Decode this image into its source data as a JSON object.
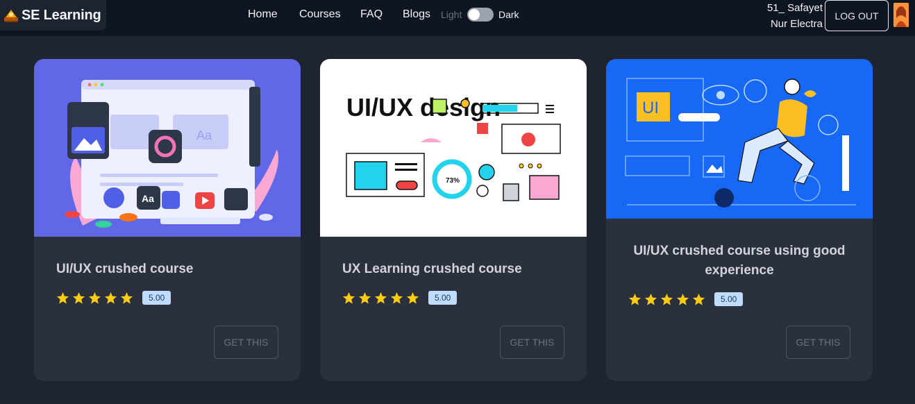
{
  "navbar": {
    "brand": "SE Learning",
    "links": [
      "Home",
      "Courses",
      "FAQ",
      "Blogs"
    ],
    "theme_light": "Light",
    "theme_dark": "Dark",
    "user_name": "51_ Safayet Nur Electra",
    "logout": "LOG OUT"
  },
  "courses": [
    {
      "title": "UI/UX crushed course",
      "rating": "5.00",
      "stars": 5,
      "button": "GET THIS"
    },
    {
      "title": "UX Learning crushed course",
      "rating": "5.00",
      "stars": 5,
      "button": "GET THIS",
      "image_text": "UI/UX design"
    },
    {
      "title": "UI/UX crushed course using good experience",
      "rating": "5.00",
      "stars": 5,
      "button": "GET THIS",
      "image_text": "UI"
    }
  ],
  "colors": {
    "page_bg": "#1e2430",
    "navbar_bg": "#0f1521",
    "card_bg": "#2a303c",
    "star": "#facc15",
    "badge_bg": "#bfdbfe"
  },
  "icons": [
    "se-learning-logo-icon",
    "star-icon",
    "avatar"
  ]
}
